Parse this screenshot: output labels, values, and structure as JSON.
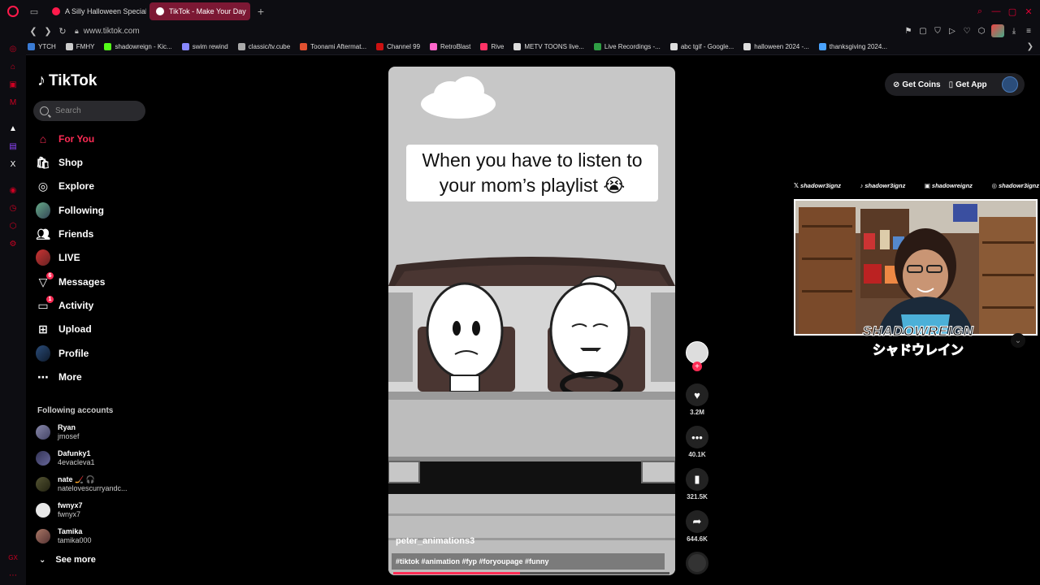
{
  "browser": {
    "tabs": [
      {
        "title": "A Silly Halloween Special",
        "active": false,
        "favicon_color": "#ff1a4b"
      },
      {
        "title": "TikTok - Make Your Day",
        "active": true,
        "favicon_color": "#ffffff"
      }
    ],
    "url": "www.tiktok.com",
    "bookmarks": [
      {
        "label": "YTCH",
        "color": "#3a7bd5"
      },
      {
        "label": "FMHY",
        "color": "#cccccc"
      },
      {
        "label": "shadowreign - Kic...",
        "color": "#53fc18"
      },
      {
        "label": "swim rewind",
        "color": "#8888ff"
      },
      {
        "label": "classic/tv.cube",
        "color": "#aaaaaa"
      },
      {
        "label": "Toonami Aftermat...",
        "color": "#e05030"
      },
      {
        "label": "Channel 99",
        "color": "#cc1111"
      },
      {
        "label": "RetroBlast",
        "color": "#ff66cc"
      },
      {
        "label": "Rive",
        "color": "#ff3366"
      },
      {
        "label": "METV TOONS live...",
        "color": "#dddddd"
      },
      {
        "label": "Live Recordings -...",
        "color": "#2f9e44"
      },
      {
        "label": "abc tgif - Google...",
        "color": "#dddddd"
      },
      {
        "label": "halloween 2024 -...",
        "color": "#dddddd"
      },
      {
        "label": "thanksgiving 2024...",
        "color": "#4aa3ff"
      }
    ]
  },
  "tiktok": {
    "logo": "TikTok",
    "search_placeholder": "Search",
    "nav": [
      {
        "label": "For You",
        "icon": "home-icon",
        "active": true
      },
      {
        "label": "Shop",
        "icon": "shop-icon"
      },
      {
        "label": "Explore",
        "icon": "compass-icon"
      },
      {
        "label": "Following",
        "icon": "following-avatar"
      },
      {
        "label": "Friends",
        "icon": "friends-icon"
      },
      {
        "label": "LIVE",
        "icon": "live-avatar"
      },
      {
        "label": "Messages",
        "icon": "messages-icon",
        "badge": "6"
      },
      {
        "label": "Activity",
        "icon": "activity-icon",
        "badge": "1"
      },
      {
        "label": "Upload",
        "icon": "upload-icon"
      },
      {
        "label": "Profile",
        "icon": "profile-avatar"
      },
      {
        "label": "More",
        "icon": "more-icon"
      }
    ],
    "following_title": "Following accounts",
    "following": [
      {
        "name": "Ryan",
        "handle": "jmosef"
      },
      {
        "name": "Dafunky1",
        "handle": "4evacleva1"
      },
      {
        "name": "nate 🏒 🎧",
        "handle": "natelovescurryandc..."
      },
      {
        "name": "fwnyx7",
        "handle": "fwnyx7"
      },
      {
        "name": "Tamika",
        "handle": "tamika000"
      }
    ],
    "see_more": "See more",
    "get_coins": "Get Coins",
    "get_app": "Get App"
  },
  "video": {
    "caption": "When you have to listen to your mom’s playlist 😭",
    "username": "peter_animations3",
    "hashtags": "#tiktok #animation #fyp #foryoupage #funny",
    "progress": 0.46,
    "likes": "3.2M",
    "comments": "40.1K",
    "saves": "321.5K",
    "shares": "644.6K"
  },
  "stream_overlay": {
    "socials": [
      {
        "icon": "x-icon",
        "handle": "shadowr3ignz"
      },
      {
        "icon": "tiktok-icon",
        "handle": "shadowr3ignz"
      },
      {
        "icon": "twitch-icon",
        "handle": "shadowreignz"
      },
      {
        "icon": "instagram-icon",
        "handle": "shadowr3ignz"
      }
    ],
    "name": "SHADOWREIGN",
    "name_jp": "シャドウレイン"
  }
}
